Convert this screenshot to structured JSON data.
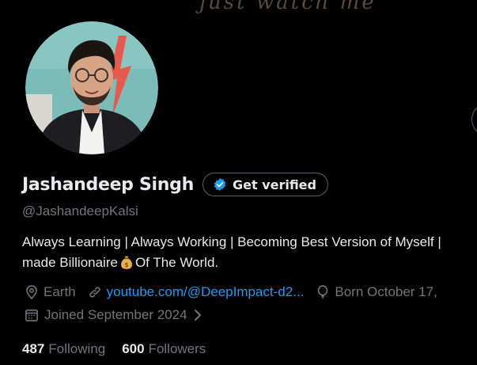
{
  "banner": {
    "script_text": "just watch me"
  },
  "profile": {
    "display_name": "Jashandeep Singh",
    "get_verified_label": "Get verified",
    "handle": "@JashandeepKalsi",
    "bio_line1": "Always Learning | Always Working | Becoming Best Version of Myself |",
    "bio_line2_before": "made Billionaire",
    "bio_line2_after": "Of The World.",
    "location": "Earth",
    "website": "youtube.com/@DeepImpact-d2...",
    "born": "Born October 17,",
    "joined": "Joined September 2024",
    "following_count": "487",
    "following_label": "Following",
    "followers_count": "600",
    "followers_label": "Followers"
  },
  "icons": {
    "verify": "verified-badge-icon",
    "moneybag": "moneybag-emoji-icon",
    "location": "location-pin-icon",
    "link": "link-icon",
    "birthday": "balloon-icon",
    "calendar": "calendar-icon",
    "chevron": "chevron-right-icon"
  },
  "colors": {
    "background": "#000000",
    "text_primary": "#e7e9ea",
    "text_secondary": "#71767b",
    "link": "#1d9bf0",
    "border": "#536471"
  }
}
